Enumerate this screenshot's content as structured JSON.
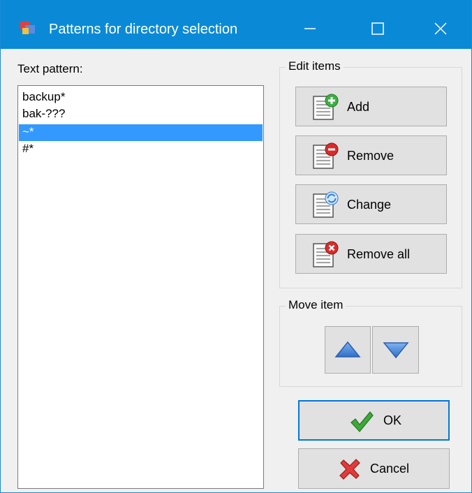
{
  "window": {
    "title": "Patterns for directory selection"
  },
  "pattern_list": {
    "label": "Text pattern:",
    "items": [
      "backup*",
      "bak-???",
      "~*",
      "#*"
    ],
    "selected_index": 2
  },
  "edit_items": {
    "title": "Edit items",
    "add_label": "Add",
    "remove_label": "Remove",
    "change_label": "Change",
    "remove_all_label": "Remove all"
  },
  "move_item": {
    "title": "Move item"
  },
  "dialog": {
    "ok_label": "OK",
    "cancel_label": "Cancel"
  },
  "colors": {
    "titlebar": "#0a8ad6",
    "selection": "#3399ff",
    "focus": "#0078d7"
  }
}
